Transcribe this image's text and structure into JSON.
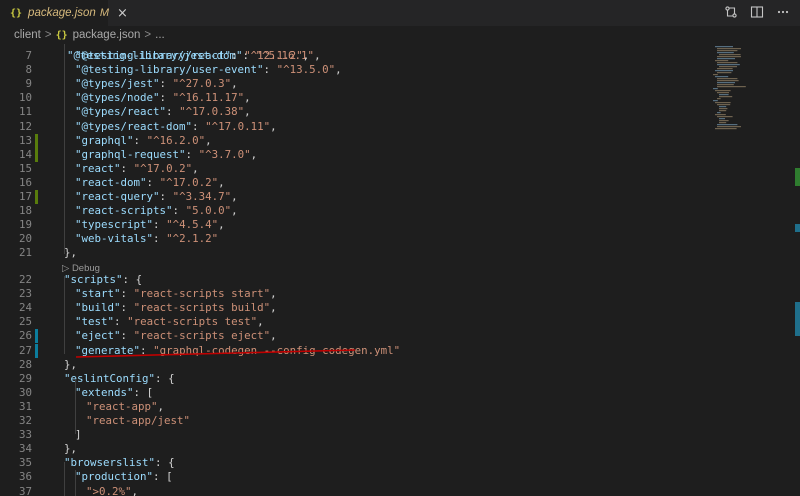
{
  "tab": {
    "icon": "json-braces-icon",
    "icon_text": "{}",
    "filename": "package.json",
    "modified": "M",
    "close": "×"
  },
  "breadcrumb": {
    "folder": "client",
    "separator": ">",
    "file_icon_text": "{}",
    "file": "package.json",
    "separator2": ">",
    "tail": "..."
  },
  "colors": {
    "key": "#9cdcfe",
    "string": "#ce9178",
    "punctuation": "#d4d4d4",
    "gutter_added": "#587c0c",
    "gutter_modified": "#0c7d9d",
    "annotation": "#c00000"
  },
  "lens": {
    "label": "▷ Debug"
  },
  "lines": [
    {
      "n": "7",
      "indent": 1,
      "key": "@testing-library/react",
      "val": "^12.1.2",
      "end": ","
    },
    {
      "n": "8",
      "indent": 1,
      "key": "@testing-library/user-event",
      "val": "^13.5.0",
      "end": ","
    },
    {
      "n": "9",
      "indent": 1,
      "key": "@types/jest",
      "val": "^27.0.3",
      "end": ","
    },
    {
      "n": "10",
      "indent": 1,
      "key": "@types/node",
      "val": "^16.11.17",
      "end": ","
    },
    {
      "n": "11",
      "indent": 1,
      "key": "@types/react",
      "val": "^17.0.38",
      "end": ","
    },
    {
      "n": "12",
      "indent": 1,
      "key": "@types/react-dom",
      "val": "^17.0.11",
      "end": ","
    },
    {
      "n": "13",
      "indent": 1,
      "key": "graphql",
      "val": "^16.2.0",
      "end": ","
    },
    {
      "n": "14",
      "indent": 1,
      "key": "graphql-request",
      "val": "^3.7.0",
      "end": ","
    },
    {
      "n": "15",
      "indent": 1,
      "key": "react",
      "val": "^17.0.2",
      "end": ","
    },
    {
      "n": "16",
      "indent": 1,
      "key": "react-dom",
      "val": "^17.0.2",
      "end": ","
    },
    {
      "n": "17",
      "indent": 1,
      "key": "react-query",
      "val": "^3.34.7",
      "end": ","
    },
    {
      "n": "18",
      "indent": 1,
      "key": "react-scripts",
      "val": "5.0.0",
      "end": ","
    },
    {
      "n": "19",
      "indent": 1,
      "key": "typescript",
      "val": "^4.5.4",
      "end": ","
    },
    {
      "n": "20",
      "indent": 1,
      "key": "web-vitals",
      "val": "^2.1.2",
      "end": ""
    },
    {
      "n": "21",
      "indent": 0,
      "text": "},"
    },
    {
      "n": "22",
      "indent": 0,
      "key": "scripts",
      "open": "{"
    },
    {
      "n": "23",
      "indent": 1,
      "key": "start",
      "val": "react-scripts start",
      "end": ","
    },
    {
      "n": "24",
      "indent": 1,
      "key": "build",
      "val": "react-scripts build",
      "end": ","
    },
    {
      "n": "25",
      "indent": 1,
      "key": "test",
      "val": "react-scripts test",
      "end": ","
    },
    {
      "n": "26",
      "indent": 1,
      "key": "eject",
      "val": "react-scripts eject",
      "end": ","
    },
    {
      "n": "27",
      "indent": 1,
      "key": "generate",
      "val": "graphql-codegen --config codegen.yml",
      "end": ""
    },
    {
      "n": "28",
      "indent": 0,
      "text": "},"
    },
    {
      "n": "29",
      "indent": 0,
      "key": "eslintConfig",
      "open": "{"
    },
    {
      "n": "30",
      "indent": 1,
      "key": "extends",
      "open": "["
    },
    {
      "n": "31",
      "indent": 2,
      "str": "react-app",
      "end": ","
    },
    {
      "n": "32",
      "indent": 2,
      "str": "react-app/jest",
      "end": ""
    },
    {
      "n": "33",
      "indent": 1,
      "text": "]"
    },
    {
      "n": "34",
      "indent": 0,
      "text": "},"
    },
    {
      "n": "35",
      "indent": 0,
      "key": "browserslist",
      "open": "{"
    },
    {
      "n": "36",
      "indent": 1,
      "key": "production",
      "open": "["
    },
    {
      "n": "37",
      "indent": 2,
      "str": ">0.2%",
      "end": ","
    }
  ]
}
